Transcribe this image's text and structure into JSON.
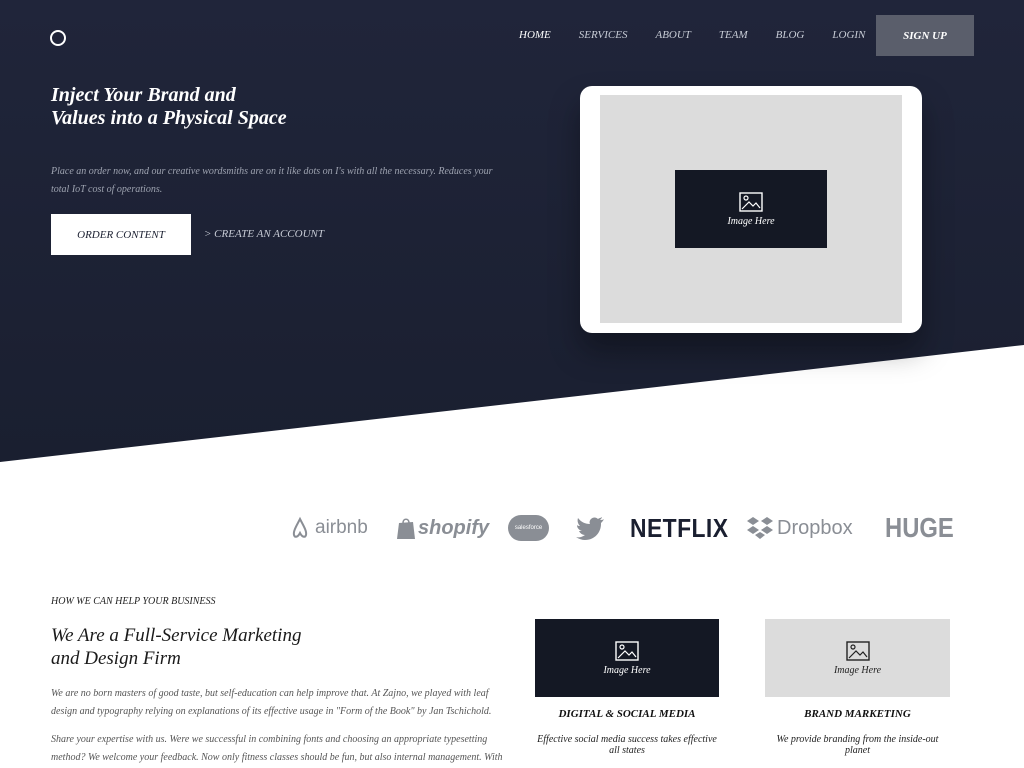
{
  "nav": {
    "items": [
      "HOME",
      "SERVICES",
      "ABOUT",
      "TEAM",
      "BLOG",
      "LOGIN"
    ],
    "signup_label": "SIGN UP"
  },
  "hero": {
    "title_line1": "Inject Your Brand and",
    "title_line2": "Values into a Physical Space",
    "text": "Place an order now, and our creative wordsmiths are on it like dots on I's with all the necessary. Reduces your total IoT cost of operations.",
    "order_label": "ORDER CONTENT",
    "create_label": "> CREATE AN ACCOUNT",
    "image_label": "Image Here"
  },
  "brands": [
    "airbnb",
    "shopify",
    "salesforce",
    "twitter",
    "NETFLIX",
    "Dropbox",
    "HUGE"
  ],
  "services": {
    "label": "HOW WE CAN HELP YOUR BUSINESS",
    "title_line1": "We Are a Full-Service Marketing",
    "title_line2": "and Design Firm",
    "p1": "We are no born masters of good taste, but self-education can help improve that. At Zajno, we played with leaf design and typography relying on explanations of its effective usage in \"Form of the Book\" by Jan Tschichold.",
    "p2": "Share your expertise with us. Were we successful in combining fonts and choosing an appropriate typesetting method? We welcome your feedback. Now only fitness classes should be fun, but also internal management. With",
    "cards": [
      {
        "image_label": "Image Here",
        "title": "DIGITAL & SOCIAL MEDIA",
        "desc": "Effective social media success takes effective all states"
      },
      {
        "image_label": "Image Here",
        "title": "BRAND MARKETING",
        "desc": "We provide branding from the inside-out planet"
      }
    ]
  }
}
